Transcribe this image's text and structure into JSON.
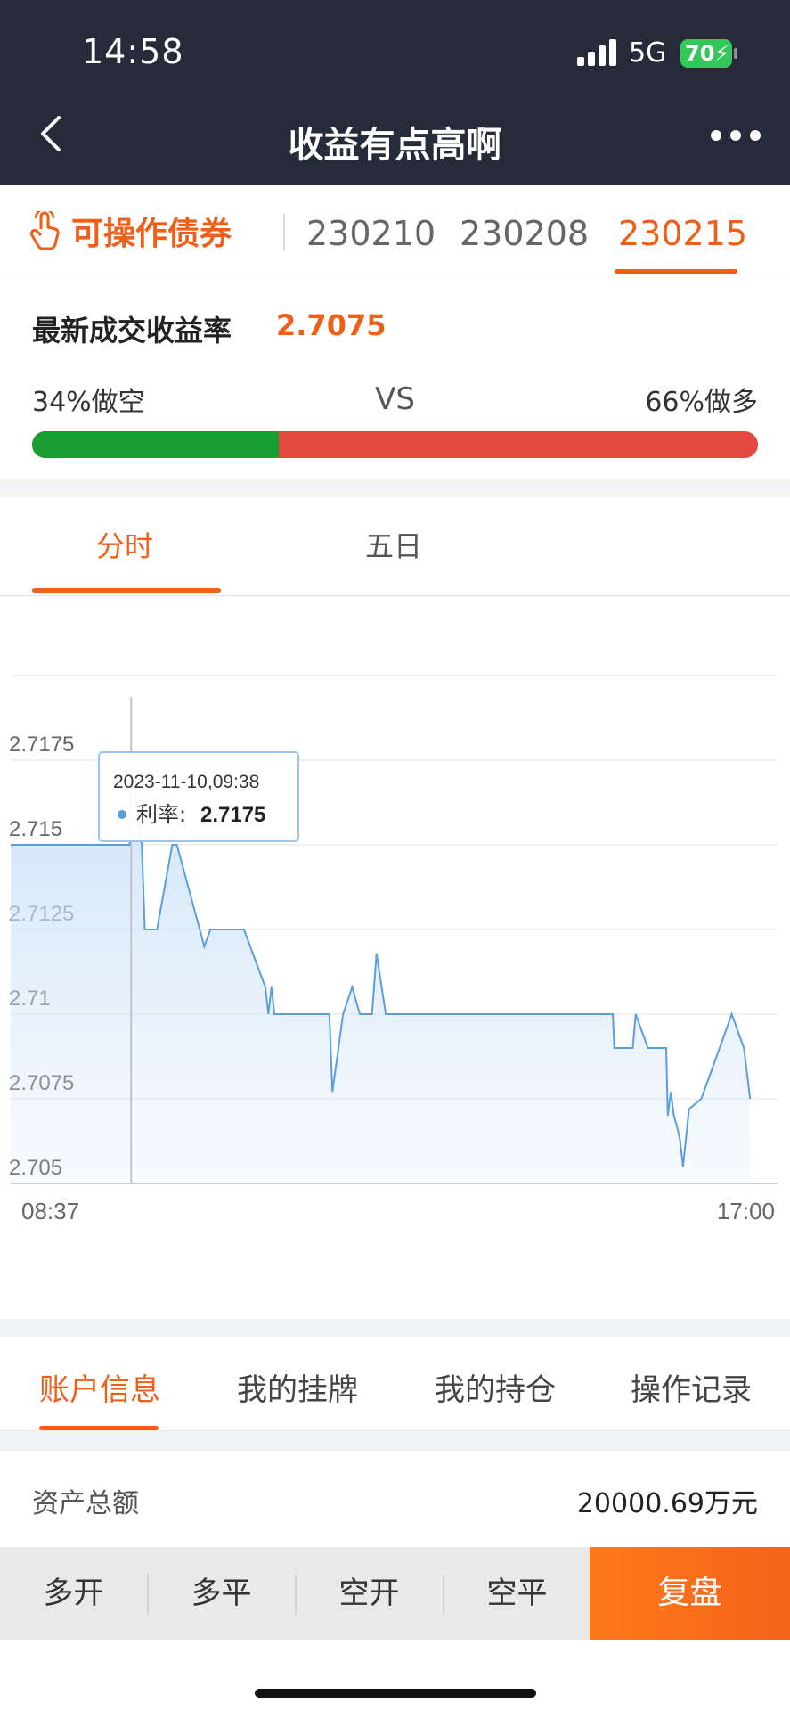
{
  "status_bar": {
    "time": "14:58",
    "network": "5G",
    "battery": "70"
  },
  "header": {
    "title": "收益有点高啊"
  },
  "bond_tabs": {
    "operable_label": "可操作债券",
    "items": [
      "230210",
      "230208",
      "230215"
    ],
    "active_index": 2
  },
  "rate_info": {
    "label": "最新成交收益率",
    "value": "2.7075",
    "short_label": "34%做空",
    "vs": "VS",
    "long_label": "66%做多",
    "short_fraction": 0.34,
    "colors": {
      "short": "#1a9e34",
      "long": "#e5483d",
      "accent": "#f05f1a"
    }
  },
  "chart_tabs": {
    "items": [
      "分时",
      "五日"
    ],
    "active_index": 0
  },
  "chart_data": {
    "type": "area",
    "title": "",
    "xlabel": "",
    "ylabel": "",
    "x_tick_labels": [
      "08:37",
      "17:00"
    ],
    "y_tick_labels": [
      "2.7175",
      "2.715",
      "2.7125",
      "2.71",
      "2.7075",
      "2.705"
    ],
    "ylim": [
      2.705,
      2.72
    ],
    "x_range_minutes": [
      517,
      1020
    ],
    "grid": true,
    "series": [
      {
        "points": [
          [
            517,
            2.715
          ],
          [
            595,
            2.715
          ],
          [
            596,
            2.7175
          ],
          [
            600,
            2.716
          ],
          [
            603,
            2.715
          ],
          [
            605,
            2.7125
          ],
          [
            613,
            2.7125
          ],
          [
            623,
            2.715
          ],
          [
            626,
            2.715
          ],
          [
            644,
            2.712
          ],
          [
            648,
            2.7125
          ],
          [
            670,
            2.7125
          ],
          [
            684,
            2.7108
          ],
          [
            686,
            2.71
          ],
          [
            688,
            2.7108
          ],
          [
            690,
            2.71
          ],
          [
            726,
            2.71
          ],
          [
            728,
            2.7077
          ],
          [
            735,
            2.71
          ],
          [
            741,
            2.7108
          ],
          [
            746,
            2.71
          ],
          [
            754,
            2.71
          ],
          [
            757,
            2.7118
          ],
          [
            763,
            2.71
          ],
          [
            912,
            2.71
          ],
          [
            913,
            2.709
          ],
          [
            925,
            2.709
          ],
          [
            927,
            2.71
          ],
          [
            935,
            2.709
          ],
          [
            947,
            2.709
          ],
          [
            948,
            2.707
          ],
          [
            950,
            2.7077
          ],
          [
            952,
            2.707
          ],
          [
            954,
            2.7067
          ],
          [
            956,
            2.7063
          ],
          [
            958,
            2.7055
          ],
          [
            962,
            2.7072
          ],
          [
            970,
            2.7075
          ],
          [
            978,
            2.7085
          ],
          [
            986,
            2.7095
          ],
          [
            990,
            2.71
          ],
          [
            998,
            2.709
          ],
          [
            1002,
            2.7075
          ]
        ]
      }
    ],
    "tooltip": {
      "date": "2023-11-10,09:38",
      "label": "利率:",
      "value": "2.7175"
    },
    "colors": {
      "line": "#5b9ee0",
      "fill": "#cfe3f7",
      "grid": "#ececec",
      "axis_text": "#666"
    }
  },
  "account_tabs": {
    "items": [
      "账户信息",
      "我的挂牌",
      "我的持仓",
      "操作记录"
    ],
    "active_index": 0
  },
  "assets": {
    "label": "资产总额",
    "value": "20000.69万元"
  },
  "actions": {
    "items": [
      "多开",
      "多平",
      "空开",
      "空平"
    ],
    "primary": "复盘"
  }
}
